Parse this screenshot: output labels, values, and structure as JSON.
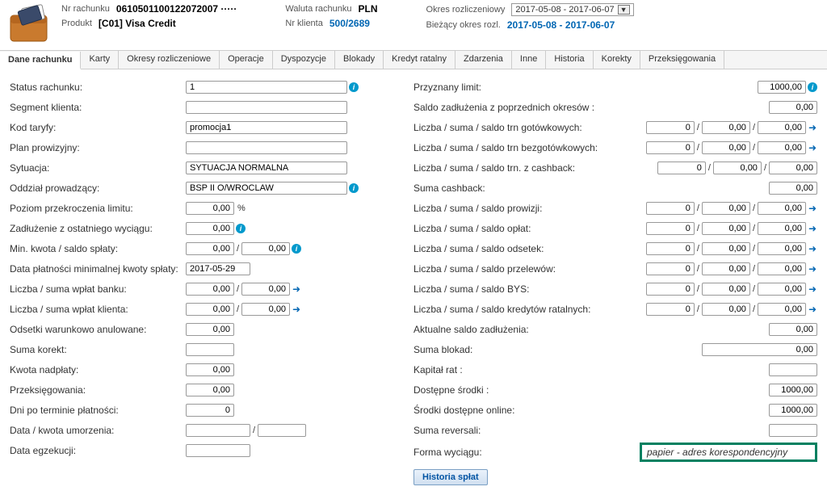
{
  "header": {
    "acct_label": "Nr rachunku",
    "acct_value": "0610501100122072007 ·····",
    "product_label": "Produkt",
    "product_value": "[C01] Visa Credit",
    "currency_label": "Waluta rachunku",
    "currency_value": "PLN",
    "client_label": "Nr klienta",
    "client_value": "500/2689",
    "period_label": "Okres rozliczeniowy",
    "period_value": "2017-05-08 - 2017-06-07",
    "curperiod_label": "Bieżący okres rozl.",
    "curperiod_value": "2017-05-08 - 2017-06-07"
  },
  "tabs": [
    "Dane rachunku",
    "Karty",
    "Okresy rozliczeniowe",
    "Operacje",
    "Dyspozycje",
    "Blokady",
    "Kredyt ratalny",
    "Zdarzenia",
    "Inne",
    "Historia",
    "Korekty",
    "Przeksięgowania"
  ],
  "left": {
    "status_label": "Status rachunku:",
    "status_value": "1",
    "segment_label": "Segment klienta:",
    "segment_value": "",
    "tariff_label": "Kod taryfy:",
    "tariff_value": "promocja1",
    "commission_label": "Plan prowizyjny:",
    "commission_value": "",
    "situation_label": "Sytuacja:",
    "situation_value": "SYTUACJA NORMALNA",
    "branch_label": "Oddział prowadzący:",
    "branch_value": "BSP II O/WROCLAW",
    "overlimit_label": "Poziom przekroczenia limitu:",
    "overlimit_value": "0,00",
    "lastdebt_label": "Zadłużenie z ostatniego wyciągu:",
    "lastdebt_value": "0,00",
    "minamt_label": "Min. kwota / saldo spłaty:",
    "minamt_v1": "0,00",
    "minamt_v2": "0,00",
    "paydate_label": "Data płatności minimalnej kwoty spłaty:",
    "paydate_value": "2017-05-29",
    "bankpay_label": "Liczba / suma wpłat banku:",
    "bankpay_v1": "0,00",
    "bankpay_v2": "0,00",
    "clientpay_label": "Liczba / suma wpłat klienta:",
    "clientpay_v1": "0,00",
    "clientpay_v2": "0,00",
    "condint_label": "Odsetki warunkowo anulowane:",
    "condint_value": "0,00",
    "sumcorr_label": "Suma korekt:",
    "sumcorr_value": "",
    "overpay_label": "Kwota nadpłaty:",
    "overpay_value": "0,00",
    "rebook_label": "Przeksięgowania:",
    "rebook_value": "0,00",
    "daysover_label": "Dni po terminie płatności:",
    "daysover_value": "0",
    "remission_label": "Data / kwota umorzenia:",
    "remission_v1": "",
    "remission_v2": "",
    "execdate_label": "Data egzekucji:",
    "execdate_value": ""
  },
  "right": {
    "limit_label": "Przyznany limit:",
    "limit_value": "1000,00",
    "prevdebt_label": "Saldo zadłużenia z poprzednich okresów :",
    "prevdebt_value": "0,00",
    "cash_label": "Liczba / suma / saldo trn gotówkowych:",
    "noncash_label": "Liczba / suma / saldo trn bezgotówkowych:",
    "cashback_label": "Liczba / suma / saldo trn. z cashback:",
    "cashbacksum_label": "Suma cashback:",
    "cashbacksum_value": "0,00",
    "comm_label": "Liczba / suma / saldo prowizji:",
    "fees_label": "Liczba / suma / saldo opłat:",
    "interest_label": "Liczba / suma / saldo odsetek:",
    "transfers_label": "Liczba / suma / saldo przelewów:",
    "bys_label": "Liczba / suma / saldo BYS:",
    "install_label": "Liczba / suma / saldo kredytów ratalnych:",
    "curdebt_label": "Aktualne saldo zadłużenia:",
    "curdebt_value": "0,00",
    "blocksum_label": "Suma blokad:",
    "blocksum_value": "0,00",
    "capital_label": "Kapitał rat :",
    "capital_value": "",
    "avail_label": "Dostępne środki :",
    "avail_value": "1000,00",
    "availonline_label": "Środki dostępne online:",
    "availonline_value": "1000,00",
    "reversal_label": "Suma reversali:",
    "reversal_value": "",
    "statement_label": "Forma wyciągu:",
    "statement_value": "papier - adres korespondencyjny",
    "hist_btn": "Historia spłat",
    "tr_n": "0",
    "tr_s": "0,00",
    "tr_b": "0,00"
  }
}
